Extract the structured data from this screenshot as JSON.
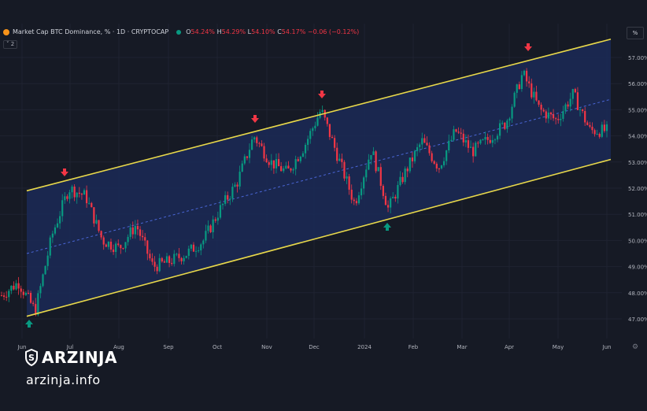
{
  "header": {
    "symbol": "Market Cap BTC Dominance, % · 1D · CRYPTOCAP",
    "open_label": "O",
    "open": "54.24%",
    "high_label": "H",
    "high": "54.29%",
    "low_label": "L",
    "low": "54.10%",
    "close_label": "C",
    "close": "54.17%",
    "change": "−0.06 (−0.12%)",
    "indicator_count": "2",
    "scale_button": "%"
  },
  "colors": {
    "background": "#161a25",
    "channel_fill": "#1b2a57",
    "channel_line": "#e8d84a",
    "median_line": "#4a66d6",
    "up_candle": "#089981",
    "down_candle": "#f23645",
    "arrow_down": "#f23645",
    "arrow_up": "#089981"
  },
  "icons": {
    "settings": "gear-icon",
    "brand": "arzinja-logo-icon"
  },
  "brand": {
    "name": "ARZINJA",
    "url": "arzinja.info"
  },
  "chart_data": {
    "type": "candlestick",
    "title": "Market Cap BTC Dominance, % · 1D · CRYPTOCAP",
    "y_ticks": [
      "57.00%",
      "56.00%",
      "55.00%",
      "54.00%",
      "53.00%",
      "52.00%",
      "51.00%",
      "50.00%",
      "49.00%",
      "48.00%",
      "47.00%"
    ],
    "x_ticks": [
      "Jun",
      "Jul",
      "Aug",
      "Sep",
      "Oct",
      "Nov",
      "Dec",
      "2024",
      "Feb",
      "Mar",
      "Apr",
      "May",
      "Jun"
    ],
    "y_range": [
      46.6,
      57.6
    ],
    "series": [
      {
        "points": [
          {
            "x": "Jun",
            "y": 47.9
          },
          {
            "x": "Jun",
            "y": 48.4
          },
          {
            "x": "Jun",
            "y": 47.3
          },
          {
            "x": "Jul",
            "y": 50.2
          },
          {
            "x": "Jul",
            "y": 52.0
          },
          {
            "x": "Jul",
            "y": 51.7
          },
          {
            "x": "Aug",
            "y": 50.0
          },
          {
            "x": "Aug",
            "y": 49.7
          },
          {
            "x": "Aug",
            "y": 50.6
          },
          {
            "x": "Sep",
            "y": 49.0
          },
          {
            "x": "Sep",
            "y": 49.2
          },
          {
            "x": "Sep",
            "y": 49.5
          },
          {
            "x": "Oct",
            "y": 50.0
          },
          {
            "x": "Oct",
            "y": 51.2
          },
          {
            "x": "Oct",
            "y": 52.2
          },
          {
            "x": "Nov",
            "y": 54.0
          },
          {
            "x": "Nov",
            "y": 53.0
          },
          {
            "x": "Nov",
            "y": 52.6
          },
          {
            "x": "Dec",
            "y": 53.6
          },
          {
            "x": "Dec",
            "y": 55.0
          },
          {
            "x": "Dec",
            "y": 53.2
          },
          {
            "x": "2024",
            "y": 51.4
          },
          {
            "x": "2024",
            "y": 53.5
          },
          {
            "x": "2024",
            "y": 51.2
          },
          {
            "x": "Feb",
            "y": 52.6
          },
          {
            "x": "Feb",
            "y": 53.8
          },
          {
            "x": "Feb",
            "y": 52.8
          },
          {
            "x": "Mar",
            "y": 54.2
          },
          {
            "x": "Mar",
            "y": 53.4
          },
          {
            "x": "Mar",
            "y": 53.9
          },
          {
            "x": "Apr",
            "y": 54.5
          },
          {
            "x": "Apr",
            "y": 56.4
          },
          {
            "x": "Apr",
            "y": 55.0
          },
          {
            "x": "May",
            "y": 54.6
          },
          {
            "x": "May",
            "y": 55.6
          },
          {
            "x": "May",
            "y": 54.2
          },
          {
            "x": "Jun",
            "y": 54.2
          }
        ]
      }
    ],
    "channel": {
      "upper": [
        {
          "x": "Jun",
          "y": 51.9
        },
        {
          "x": "Jun",
          "y": 57.7
        }
      ],
      "lower": [
        {
          "x": "Jun",
          "y": 47.1
        },
        {
          "x": "Jun",
          "y": 53.1
        }
      ]
    },
    "grid": true,
    "legend": "top-left"
  }
}
